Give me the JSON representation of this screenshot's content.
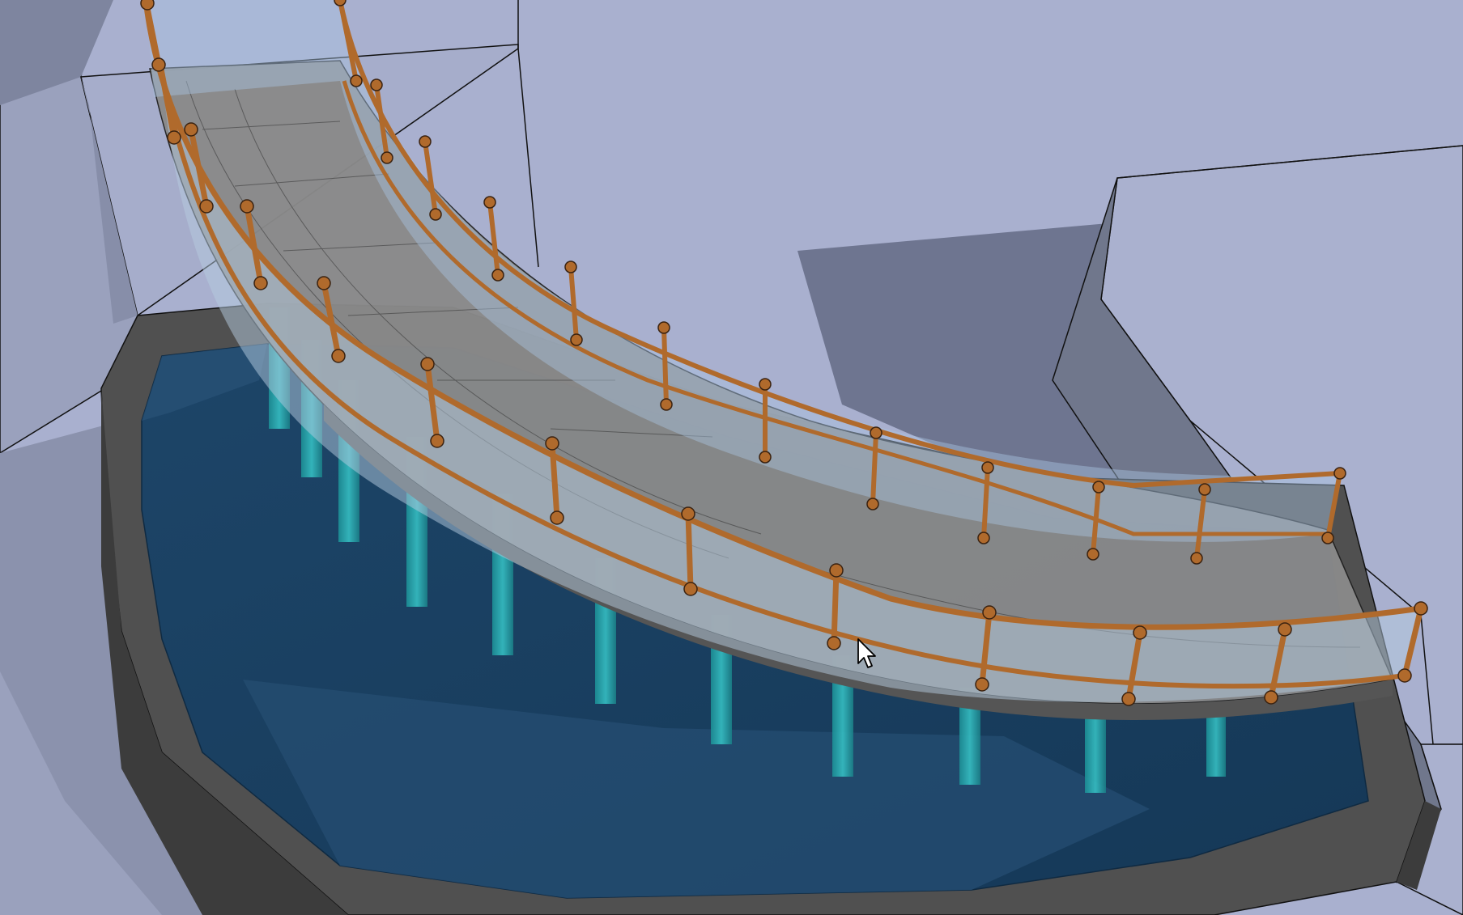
{
  "viewport": {
    "view_mode": "3d-perspective",
    "render_style": "shaded-with-edges",
    "colors": {
      "sky_background": "#a9b0cf",
      "wall_face_light": "#aab1cf",
      "wall_face_dark": "#70778c",
      "shadow": "#6e7590",
      "pool_rim": "#505050",
      "pool_rim_dark": "#3c3c3c",
      "water": "#173c5e",
      "water_light": "#244c70",
      "deck": "#8a8a8a",
      "railing_frame": "#b06a2c",
      "glass_panel": "#a8c4e0",
      "pillar": "#2aa7ae",
      "edge_line": "#111111"
    }
  },
  "model": {
    "objects": [
      {
        "name": "curved-walkway-deck",
        "type": "surface"
      },
      {
        "name": "glass-railing-outer",
        "type": "railing"
      },
      {
        "name": "glass-railing-inner",
        "type": "railing"
      },
      {
        "name": "support-pillars",
        "type": "column-group"
      },
      {
        "name": "pool-water",
        "type": "surface"
      },
      {
        "name": "pool-rim-wall",
        "type": "wall"
      },
      {
        "name": "building-block-left",
        "type": "solid"
      },
      {
        "name": "building-block-right",
        "type": "solid"
      }
    ]
  },
  "cursor": {
    "icon": "arrow-pointer-icon"
  }
}
